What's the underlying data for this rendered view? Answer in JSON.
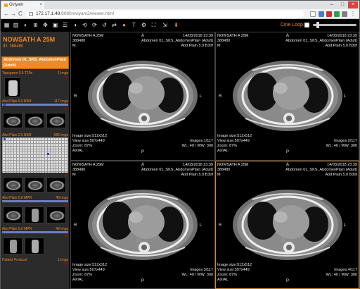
{
  "browser": {
    "tab_title": "Oviyam",
    "url_host": "172.17.1.48",
    "url_path": ":8080/oviyam2/viewer.html",
    "nav": {
      "back": "←",
      "forward": "→",
      "reload": "C"
    },
    "window": {
      "minimize": "–",
      "maximize": "□",
      "close": "×"
    }
  },
  "toolbar": {
    "cine_loop_label": "Cine Loop",
    "icons": [
      "layout-icon",
      "series-icon",
      "window-level-icon",
      "zoom-icon",
      "pan-icon",
      "move-icon",
      "scroll-icon",
      "invert-icon",
      "rotate-left-icon",
      "rotate-right-icon",
      "reset-icon",
      "flip-icon",
      "measure-icon",
      "text-icon",
      "settings-icon",
      "fullscreen-icon",
      "export-icon",
      "download-icon"
    ]
  },
  "sidebar": {
    "patient_name": "NOWSATH A 25M",
    "patient_id": "ID: 388480",
    "study_label": "Abdomen 01_SKS_AbdomenPlain (Adult)",
    "study_label_line1": "Abdomen 01_SKS_AbdomenPlain",
    "study_label_line2": "(Adult)",
    "series": [
      {
        "name": "Topogram 0.6 T20s",
        "count": "1 Imgs"
      },
      {
        "name": "Abd Plain 5.0 B30f",
        "count": "117 Imgs"
      },
      {
        "name": "Abd Plain 2.0 B30f",
        "count": "585 Imgs"
      },
      {
        "name": "Abd Plain 5.0 MPR",
        "count": "40 Imgs"
      },
      {
        "name": "Abd Plain 5.0 MPR",
        "count": "46 Imgs"
      },
      {
        "name": "Patient Protocol",
        "count": "1 Imgs"
      }
    ]
  },
  "viewports": [
    {
      "patient": "NOWSATH A 25M",
      "id": "388480",
      "sex": "M",
      "orient_top": "A",
      "date": "14/03/2018 23:39",
      "study": "Abdomen 01_SKS_AbdomenPlain (Adult)",
      "series": "Abd Plain 5.0 B30f",
      "image_size": "Image size:512x512",
      "view_size": "View size:507x449",
      "zoom": "Zoom: 87%",
      "plane": "AXIAL",
      "images": "Images:1/117",
      "wl": "WL: 40 / WW: 300",
      "left": "R",
      "right": "L",
      "bottom": "P"
    },
    {
      "patient": "NOWSATH A 25M",
      "id": "388480",
      "sex": "M",
      "orient_top": "A",
      "date": "14/03/2018 23:39",
      "study": "Abdomen 01_SKS_AbdomenPlain (Adult)",
      "series": "Abd Plain 5.0 B30f",
      "image_size": "Image size:512x512",
      "view_size": "View size:507x449",
      "zoom": "Zoom: 87%",
      "plane": "AXIAL",
      "images": "Images:2/117",
      "wl": "WL: 40 / WW: 300",
      "left": "R",
      "right": "L",
      "bottom": "P"
    },
    {
      "patient": "NOWSATH A 25M",
      "id": "388480",
      "sex": "M",
      "orient_top": "A",
      "date": "14/03/2018 23:39",
      "study": "Abdomen 01_SKS_AbdomenPlain (Adult)",
      "series": "Abd Plain 5.0 B30f",
      "image_size": "Image size:512x512",
      "view_size": "View size:507x449",
      "zoom": "Zoom: 87%",
      "plane": "AXIAL",
      "images": "Images:3/117",
      "wl": "WL: 40 / WW: 300",
      "left": "R",
      "right": "L",
      "bottom": "P"
    },
    {
      "patient": "NOWSATH A 25M",
      "id": "388480",
      "sex": "M",
      "orient_top": "A",
      "date": "14/03/2018 23:39",
      "study": "Abdomen 01_SKS_AbdomenPlain (Adult)",
      "series": "Abd Plain 5.0 B30f",
      "image_size": "Image size:512x512",
      "view_size": "View size:507x449",
      "zoom": "Zoom: 87%",
      "plane": "AXIAL",
      "images": "Images:4/117",
      "wl": "WL: 40 / WW: 300",
      "left": "R",
      "right": "L",
      "bottom": "P"
    }
  ],
  "colors": {
    "accent": "#f08a24",
    "active_border": "#d4862a",
    "series_bar": "#6d7fc0"
  }
}
